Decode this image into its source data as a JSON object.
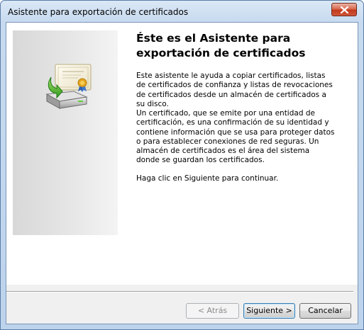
{
  "window": {
    "title": "Asistente para exportación de certificados"
  },
  "wizard": {
    "heading": "Éste es el Asistente para exportación de certificados",
    "paragraphs": [
      "Este asistente le ayuda a copiar certificados, listas de certificados de confianza y listas de revocaciones de certificados desde un almacén de certificados a su disco.",
      "Un certificado, que se emite por una entidad de certificación, es una confirmación de su identidad y contiene información que se usa para proteger datos o para establecer conexiones de red seguras. Un almacén de certificados es el área del sistema donde se guardan los certificados.",
      "Haga clic en Siguiente para continuar."
    ],
    "icon": "certificate-export-icon"
  },
  "buttons": {
    "back": "< Atrás",
    "next": "Siguiente >",
    "cancel": "Cancelar",
    "back_enabled": false
  },
  "colors": {
    "close_button": "#c7432a",
    "window_frame": "#bdd3ec"
  }
}
